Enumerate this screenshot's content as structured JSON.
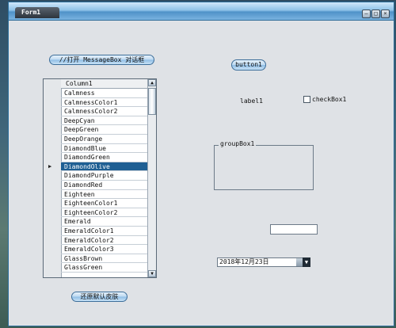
{
  "window": {
    "title": "Form1",
    "min_glyph": "–",
    "max_glyph": "□",
    "close_glyph": "×"
  },
  "buttons": {
    "messagebox_label": "//打开 MessageBox 对话框",
    "button1_label": "button1",
    "restore_skin_label": "还原默认皮肤"
  },
  "grid": {
    "column_header": "Column1",
    "selected_index": 8,
    "rows": [
      "Calmness",
      "CalmnessColor1",
      "CalmnessColor2",
      "DeepCyan",
      "DeepGreen",
      "DeepOrange",
      "DiamondBlue",
      "DiamondGreen",
      "DiamondOlive",
      "DiamondPurple",
      "DiamondRed",
      "Eighteen",
      "EighteenColor1",
      "EighteenColor2",
      "Emerald",
      "EmeraldColor1",
      "EmeraldColor2",
      "EmeraldColor3",
      "GlassBrown",
      "GlassGreen"
    ],
    "up_arrow": "▲",
    "down_arrow": "▼",
    "row_indicator": "▶"
  },
  "label1": "label1",
  "checkbox": {
    "label": "checkBox1",
    "checked": false
  },
  "groupbox": {
    "title": "groupBox1"
  },
  "textbox": {
    "value": ""
  },
  "datepicker": {
    "value": "2018年12月23日",
    "dropdown_glyph": "▼"
  },
  "colors": {
    "selection": "#1f5f93",
    "titlebar": "#4f92c8"
  }
}
